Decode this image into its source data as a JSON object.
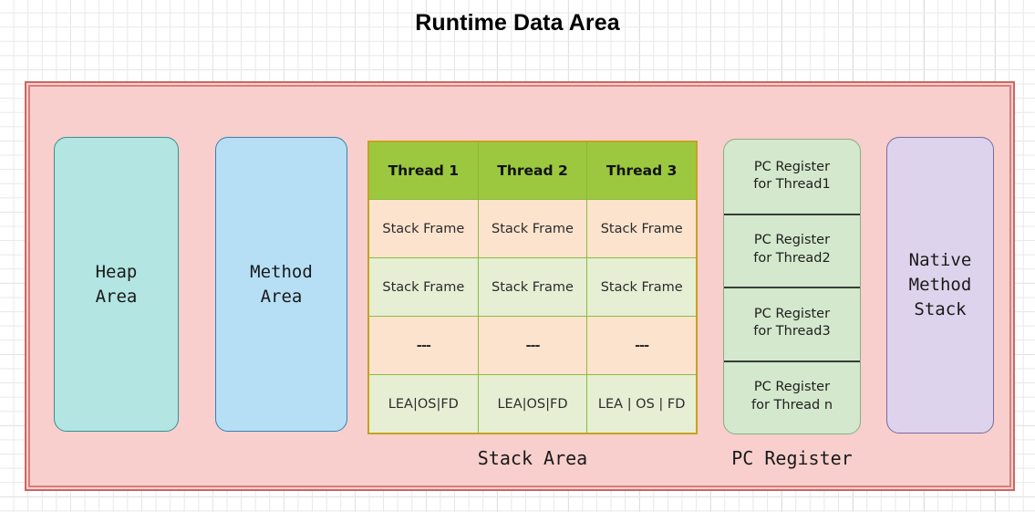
{
  "diagram": {
    "title": "Runtime Data Area",
    "colors": {
      "container_fill": "#f8cfcd",
      "container_border": "#cc6663",
      "heap_fill": "#b3e5e2",
      "method_fill": "#b6dff5",
      "native_fill": "#ddd3ec",
      "pc_fill": "#d3e8cc",
      "table_header_fill": "#9cc83f",
      "table_peach_fill": "#fce3ce",
      "table_lime_fill": "#e6efd4",
      "table_border": "#c5a21f"
    }
  },
  "heap_area": {
    "label": "Heap\nArea"
  },
  "method_area": {
    "label": "Method\nArea"
  },
  "native_method_stack": {
    "label": "Native\nMethod\nStack"
  },
  "stack_area": {
    "caption": "Stack Area",
    "headers": [
      "Thread 1",
      "Thread 2",
      "Thread 3"
    ],
    "rows": [
      [
        "Stack Frame",
        "Stack Frame",
        "Stack Frame"
      ],
      [
        "Stack Frame",
        "Stack Frame",
        "Stack Frame"
      ],
      [
        "---",
        "---",
        "---"
      ],
      [
        "LEA|OS|FD",
        "LEA|OS|FD",
        "LEA | OS | FD"
      ]
    ]
  },
  "pc_register": {
    "caption": "PC Register",
    "cells": [
      "PC Register\nfor  Thread1",
      "PC Register\nfor  Thread2",
      "PC Register\nfor  Thread3",
      "PC Register\nfor  Thread n"
    ]
  }
}
